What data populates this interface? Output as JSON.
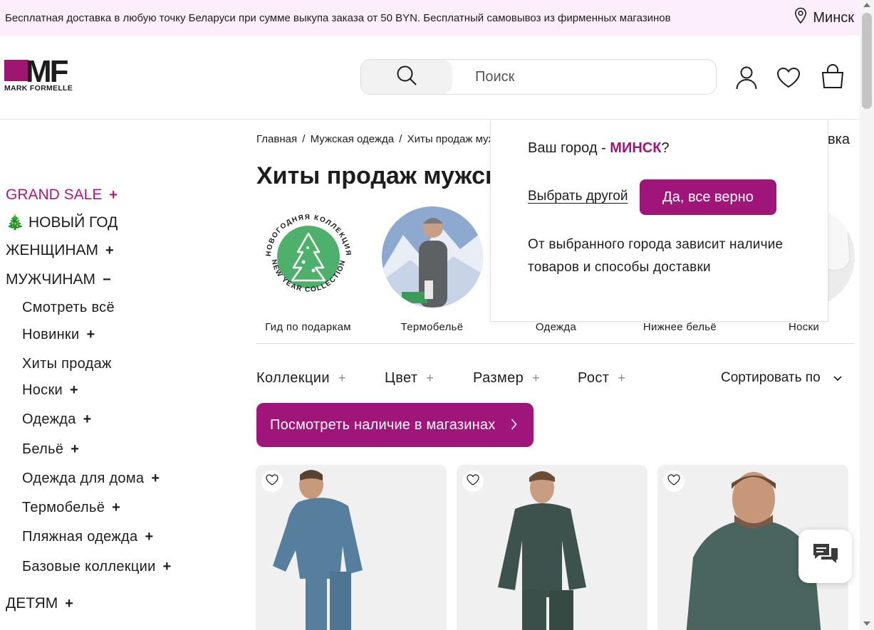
{
  "topbar": {
    "promo": "Бесплатная доставка в любую точку Беларуси при сумме выкупа заказа от 50 BYN. Бесплатный самовывоз из фирменных магазинов",
    "city": "Минск"
  },
  "header": {
    "logo_letters": "MF",
    "logo_brand": "MARK FORMELLE",
    "search_placeholder": "Поиск",
    "icons": [
      "search-icon",
      "user-icon",
      "heart-icon",
      "bag-icon"
    ]
  },
  "sidebar": {
    "top_items": [
      {
        "label": "GRAND SALE",
        "expand": "+"
      },
      {
        "label": "🎄 НОВЫЙ ГОД",
        "expand": ""
      },
      {
        "label": "ЖЕНЩИНАМ",
        "expand": "+"
      },
      {
        "label": "МУЖЧИНАМ",
        "expand": "−"
      }
    ],
    "sub_items": [
      {
        "label": "Смотреть всё",
        "expand": ""
      },
      {
        "label": "Новинки",
        "expand": "+"
      },
      {
        "label": "Хиты продаж",
        "expand": ""
      },
      {
        "label": "Носки",
        "expand": "+"
      },
      {
        "label": "Одежда",
        "expand": "+"
      },
      {
        "label": "Бельё",
        "expand": "+"
      },
      {
        "label": "Одежда для дома",
        "expand": "+"
      },
      {
        "label": "Термобельё",
        "expand": "+"
      },
      {
        "label": "Пляжная одежда",
        "expand": "+"
      },
      {
        "label": "Базовые коллекции",
        "expand": "+"
      }
    ],
    "kids": {
      "label": "ДЕТЯМ",
      "expand": "+"
    }
  },
  "breadcrumb": {
    "items": [
      "Главная",
      "/",
      "Мужская одежда",
      "/",
      "Хиты продаж мужс"
    ],
    "tail": "вка"
  },
  "page_title": "Хиты продаж мужских",
  "categories": [
    {
      "label": "Гид по подаркам",
      "badge_top": "НОВОГОДНЯЯ КОЛЛЕКЦИЯ",
      "badge_bottom": "NEW YEAR COLLECTION"
    },
    {
      "label": "Термобельё"
    },
    {
      "label": "Одежда"
    },
    {
      "label": "Нижнее бельё"
    },
    {
      "label": "Носки"
    }
  ],
  "filters": {
    "items": [
      {
        "label": "Коллекции",
        "expand": "+"
      },
      {
        "label": "Цвет",
        "expand": "+"
      },
      {
        "label": "Размер",
        "expand": "+"
      },
      {
        "label": "Рост",
        "expand": "+"
      }
    ],
    "sort_label": "Сортировать по"
  },
  "stock_button": "Посмотреть наличие в магазинах",
  "city_popup": {
    "question_prefix": "Ваш город - ",
    "city": "МИНСК",
    "question_suffix": "?",
    "choose_other": "Выбрать другой",
    "confirm": "Да, все верно",
    "note": "От выбранного города зависит наличие товаров и способы доставки"
  },
  "colors": {
    "accent": "#a0157a",
    "sale": "#b0177c",
    "topbar_bg": "#fdeefb"
  }
}
